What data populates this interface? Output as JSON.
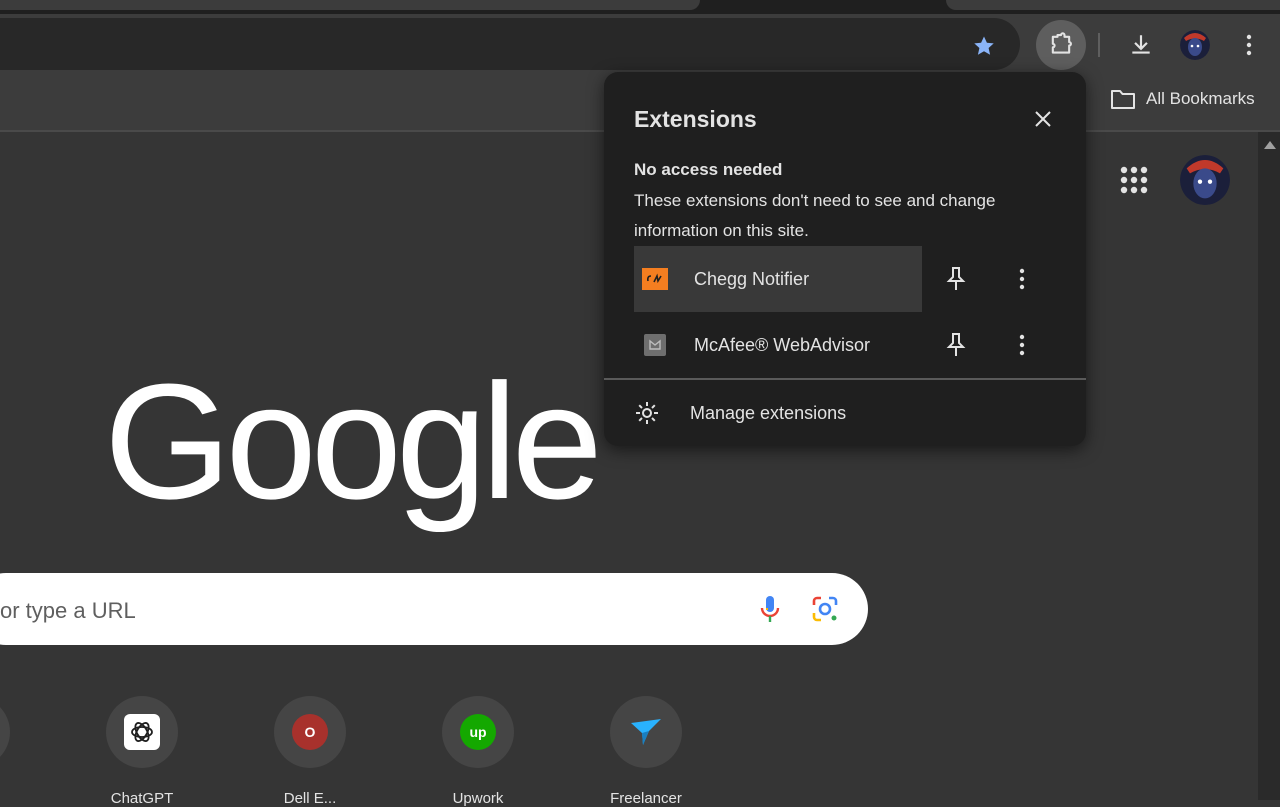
{
  "toolbar": {
    "bookmark_star_icon": "star-icon",
    "extensions_icon": "puzzle-icon",
    "download_icon": "download-icon",
    "menu_icon": "more-vert-icon"
  },
  "bookmarks_bar": {
    "all_bookmarks_label": "All Bookmarks"
  },
  "newtab": {
    "logo_text": "Google",
    "search_placeholder": "or type a URL",
    "shortcuts": [
      {
        "label": "ChatGPT",
        "letter": "",
        "color": "#ffffff"
      },
      {
        "label": "Dell E...",
        "letter": "O",
        "color": "#a8312c"
      },
      {
        "label": "Upwork",
        "letter": "up",
        "color": "#14a800"
      },
      {
        "label": "Freelancer",
        "letter": "",
        "color": "#29b2fe"
      }
    ]
  },
  "extensions_popup": {
    "title": "Extensions",
    "section_heading": "No access needed",
    "section_description": "These extensions don't need to see and change information on this site.",
    "extensions": [
      {
        "name": "Chegg Notifier",
        "icon": "chegg-icon",
        "color": "#f47e20"
      },
      {
        "name": "McAfee® WebAdvisor",
        "icon": "mcafee-icon",
        "color": "#8a8a8a"
      }
    ],
    "manage_label": "Manage extensions"
  },
  "colors": {
    "accent_star": "#8ab4f8",
    "popup_bg": "#1f1f1f",
    "page_bg": "#353535"
  }
}
